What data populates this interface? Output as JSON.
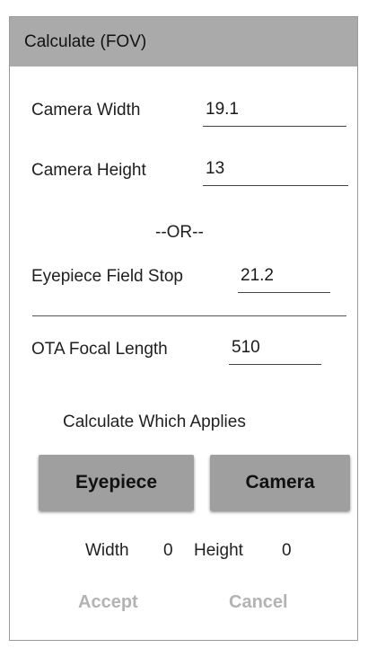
{
  "dialog": {
    "title": "Calculate (FOV)"
  },
  "fields": {
    "camera_width": {
      "label": "Camera Width",
      "value": "19.1"
    },
    "camera_height": {
      "label": "Camera Height",
      "value": "13"
    },
    "or_separator": "--OR--",
    "eyepiece_field_stop": {
      "label": "Eyepiece Field Stop",
      "value": "21.2"
    },
    "ota_focal_length": {
      "label": "OTA Focal Length",
      "value": "510"
    }
  },
  "calculate_prompt": "Calculate Which Applies",
  "buttons": {
    "eyepiece": "Eyepiece",
    "camera": "Camera"
  },
  "result": {
    "width_label": "Width",
    "width_value": "0",
    "height_label": "Height",
    "height_value": "0"
  },
  "actions": {
    "accept": "Accept",
    "cancel": "Cancel"
  },
  "colors": {
    "titlebar": "#aaaaaa",
    "button": "#9f9f9f",
    "disabled_text": "#b3b3b3"
  }
}
